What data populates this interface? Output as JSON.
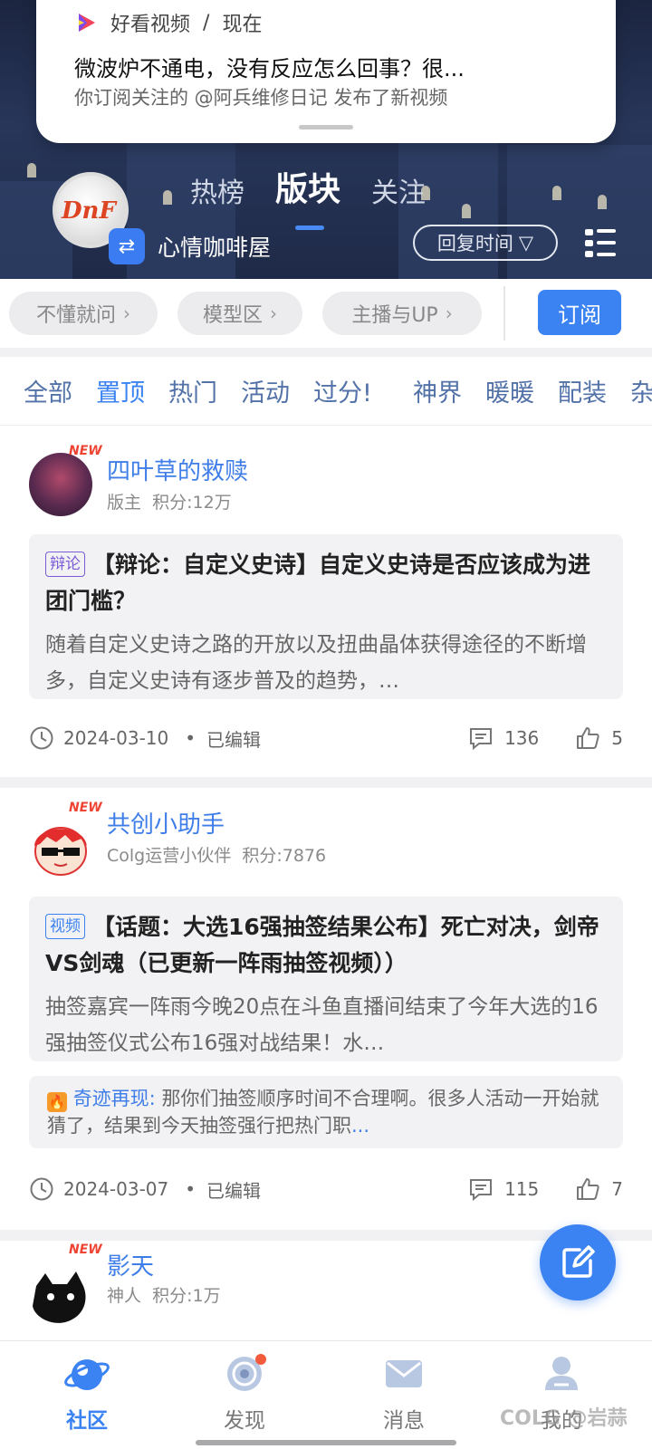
{
  "notification": {
    "app_name": "好看视频",
    "separator": "/",
    "time": "现在",
    "title": "微波炉不通电，没有反应怎么回事？很...",
    "subtitle": "你订阅关注的 @阿兵维修日记 发布了新视频"
  },
  "header": {
    "logo_text": "DnF",
    "tabs": [
      "热榜",
      "版块",
      "关注"
    ],
    "active_tab": "版块",
    "board_name": "心情咖啡屋",
    "switch_icon": "⇄",
    "sort_label": "回复时间",
    "sort_icon": "▽"
  },
  "subboards": {
    "chips": [
      "不懂就问",
      "模型区",
      "主播与UP"
    ],
    "chevron": "›",
    "subscribe_label": "订阅"
  },
  "categories": [
    "全部",
    "置顶",
    "热门",
    "活动",
    "过分!",
    "神界",
    "暖暖",
    "配装",
    "杂"
  ],
  "active_category": "置顶",
  "posts": [
    {
      "author": "四叶草的救赎",
      "rank": "版主",
      "points": "积分:12万",
      "new_tag": "NEW",
      "tag": "辩论",
      "tag_color": "#7b5bd6",
      "title": "【辩论：自定义史诗】自定义史诗是否应该成为进团门槛？",
      "excerpt": "随着自定义史诗之路的开放以及扭曲晶体获得途径的不断增多，自定义史诗有逐步普及的趋势，…",
      "date": "2024-03-10",
      "edited": "已编辑",
      "comments": "136",
      "likes": "5"
    },
    {
      "author": "共创小助手",
      "rank": "Colg运营小伙伴",
      "points": "积分:7876",
      "new_tag": "NEW",
      "tag": "视频",
      "tag_color": "#3b82f2",
      "title": "【话题：大选16强抽签结果公布】死亡对决，剑帝VS剑魂（已更新一阵雨抽签视频））",
      "excerpt": "抽签嘉宾一阵雨今晚20点在斗鱼直播间结束了今年大选的16强抽签仪式公布16强对战结果！水…",
      "reply_name": "奇迹再现:",
      "reply_text": "那你们抽签顺序时间不合理啊。很多人活动一开始就猜了，结果到今天抽签强行把热门职",
      "reply_more": "...",
      "date": "2024-03-07",
      "edited": "已编辑",
      "comments": "115",
      "likes": "7"
    },
    {
      "author": "影天",
      "rank": "神人",
      "points": "积分:1万",
      "new_tag": "NEW"
    }
  ],
  "bottom_nav": [
    {
      "label": "社区",
      "icon": "planet-icon",
      "active": true
    },
    {
      "label": "发现",
      "icon": "target-icon",
      "badge": true
    },
    {
      "label": "消息",
      "icon": "mail-icon"
    },
    {
      "label": "我的",
      "icon": "user-icon"
    }
  ],
  "watermark": "COLG @岩蒜",
  "colors": {
    "accent": "#3b82f2",
    "link": "#3f7ee8",
    "header_bg": "#1e2a47"
  }
}
